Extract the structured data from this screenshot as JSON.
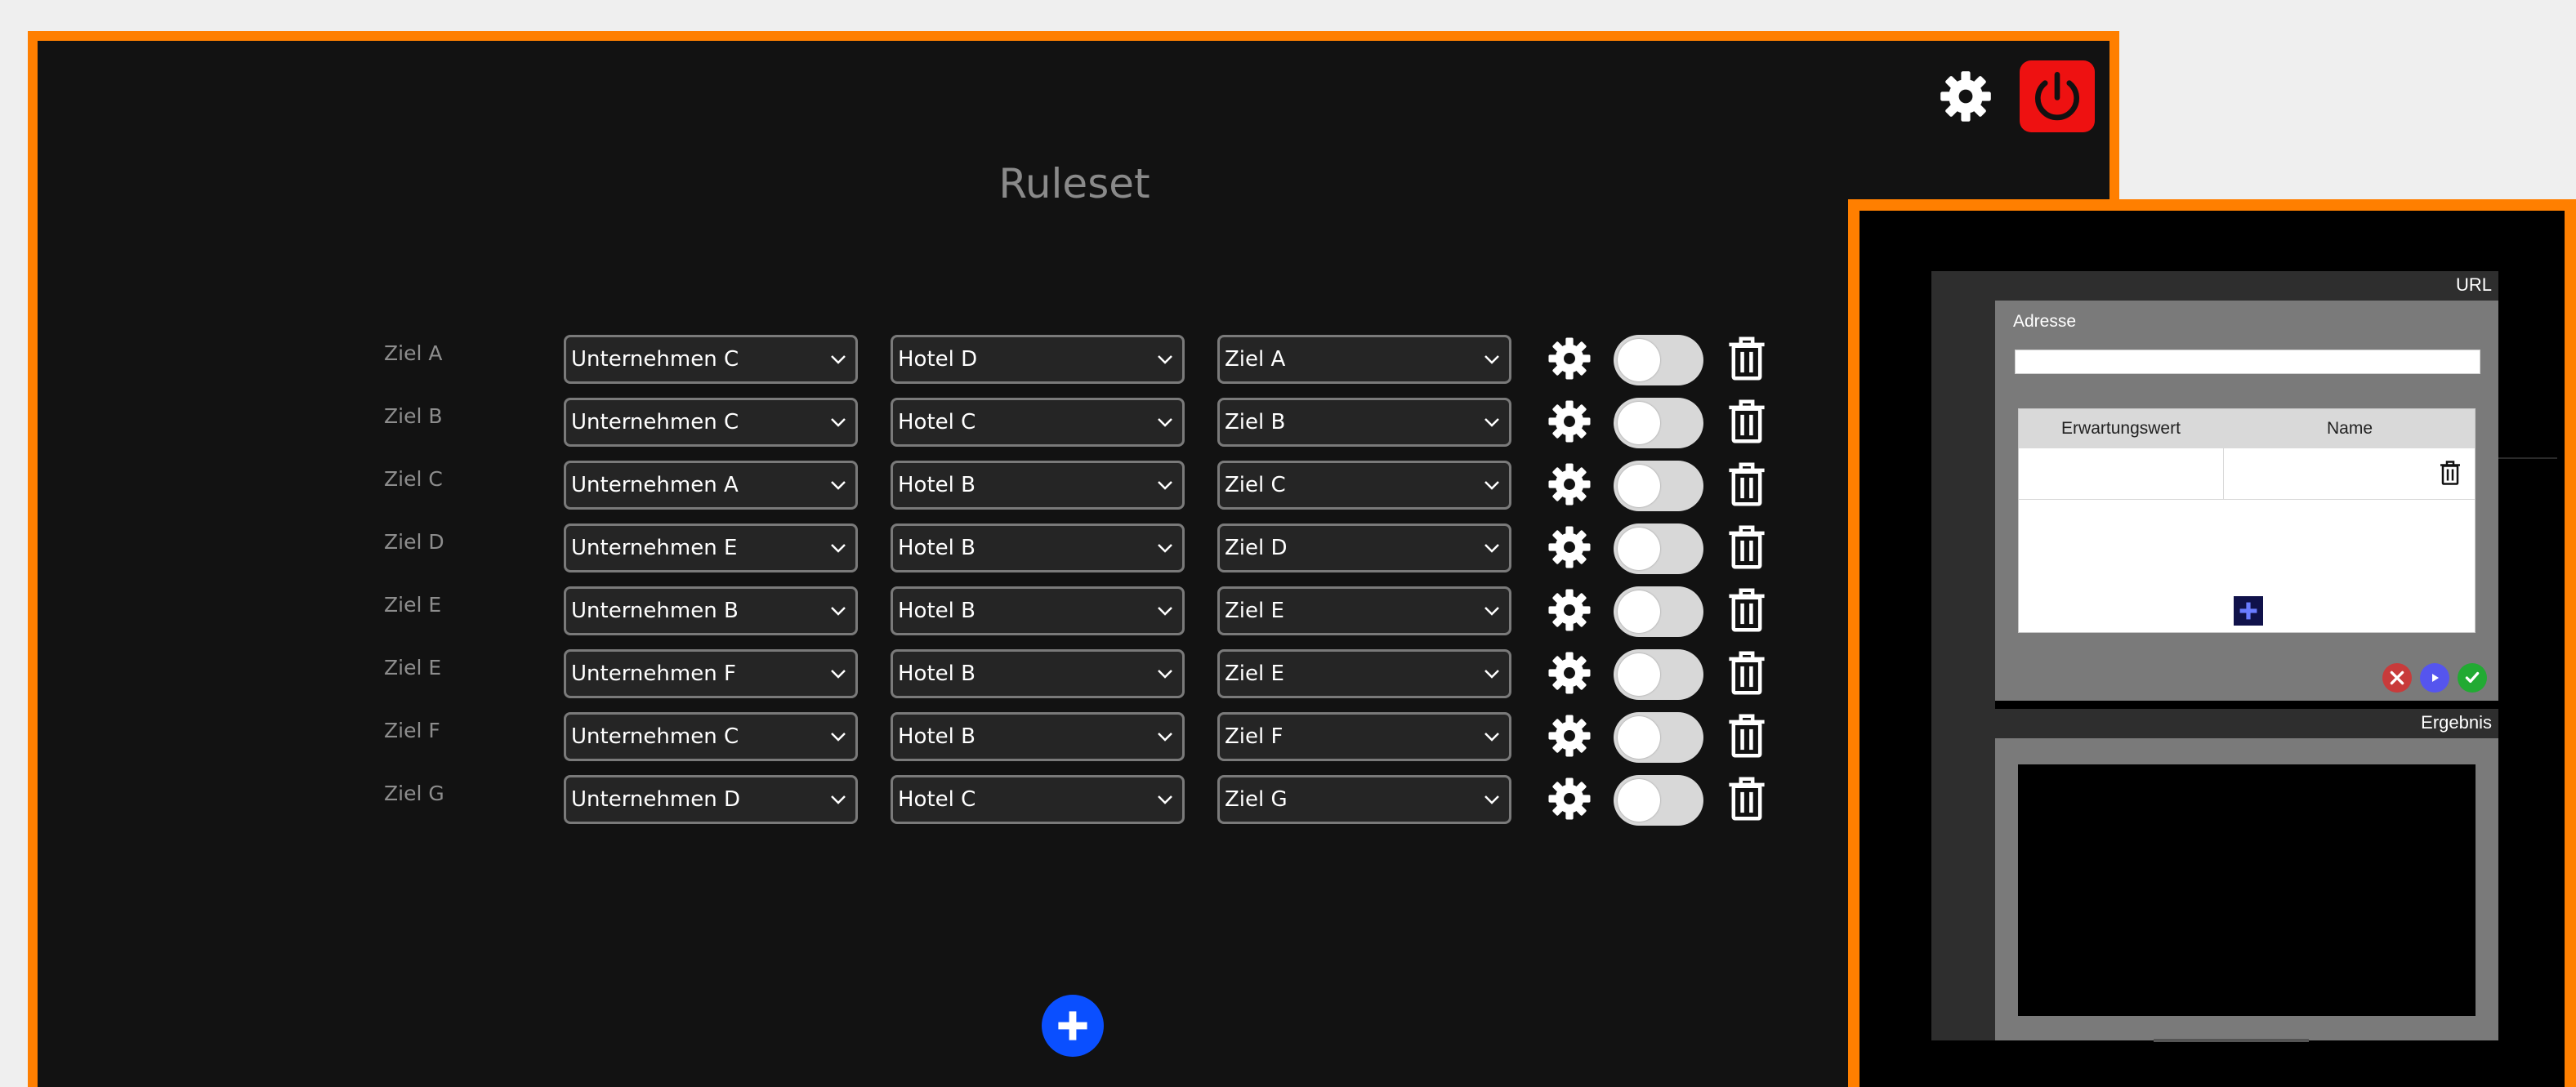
{
  "app": {
    "title": "Ruleset",
    "accent_color": "#ff7f00",
    "power_color": "#ee1111",
    "add_color": "#0a4fff"
  },
  "rules": [
    {
      "label": "Ziel A",
      "company": "Unternehmen C",
      "hotel": "Hotel D",
      "target": "Ziel A"
    },
    {
      "label": "Ziel B",
      "company": "Unternehmen C",
      "hotel": "Hotel C",
      "target": "Ziel B"
    },
    {
      "label": "Ziel C",
      "company": "Unternehmen A",
      "hotel": "Hotel B",
      "target": "Ziel C"
    },
    {
      "label": "Ziel D",
      "company": "Unternehmen E",
      "hotel": "Hotel B",
      "target": "Ziel D"
    },
    {
      "label": "Ziel E",
      "company": "Unternehmen B",
      "hotel": "Hotel B",
      "target": "Ziel E"
    },
    {
      "label": "Ziel E",
      "company": "Unternehmen F",
      "hotel": "Hotel B",
      "target": "Ziel E"
    },
    {
      "label": "Ziel F",
      "company": "Unternehmen C",
      "hotel": "Hotel B",
      "target": "Ziel F"
    },
    {
      "label": "Ziel G",
      "company": "Unternehmen D",
      "hotel": "Hotel C",
      "target": "Ziel G"
    }
  ],
  "icons": {
    "settings": "gear-icon",
    "power": "power-icon",
    "delete": "trash-icon",
    "add": "plus-icon",
    "dropdown": "chevron-down-icon"
  },
  "side_panel": {
    "url_header": "URL",
    "address_label": "Adresse",
    "address_value": "",
    "table_headers": [
      "Erwartungswert",
      "Name"
    ],
    "result_header": "Ergebnis",
    "button_colors": {
      "cancel": "#c83b3b",
      "run": "#5555ee",
      "ok": "#22aa33"
    }
  }
}
